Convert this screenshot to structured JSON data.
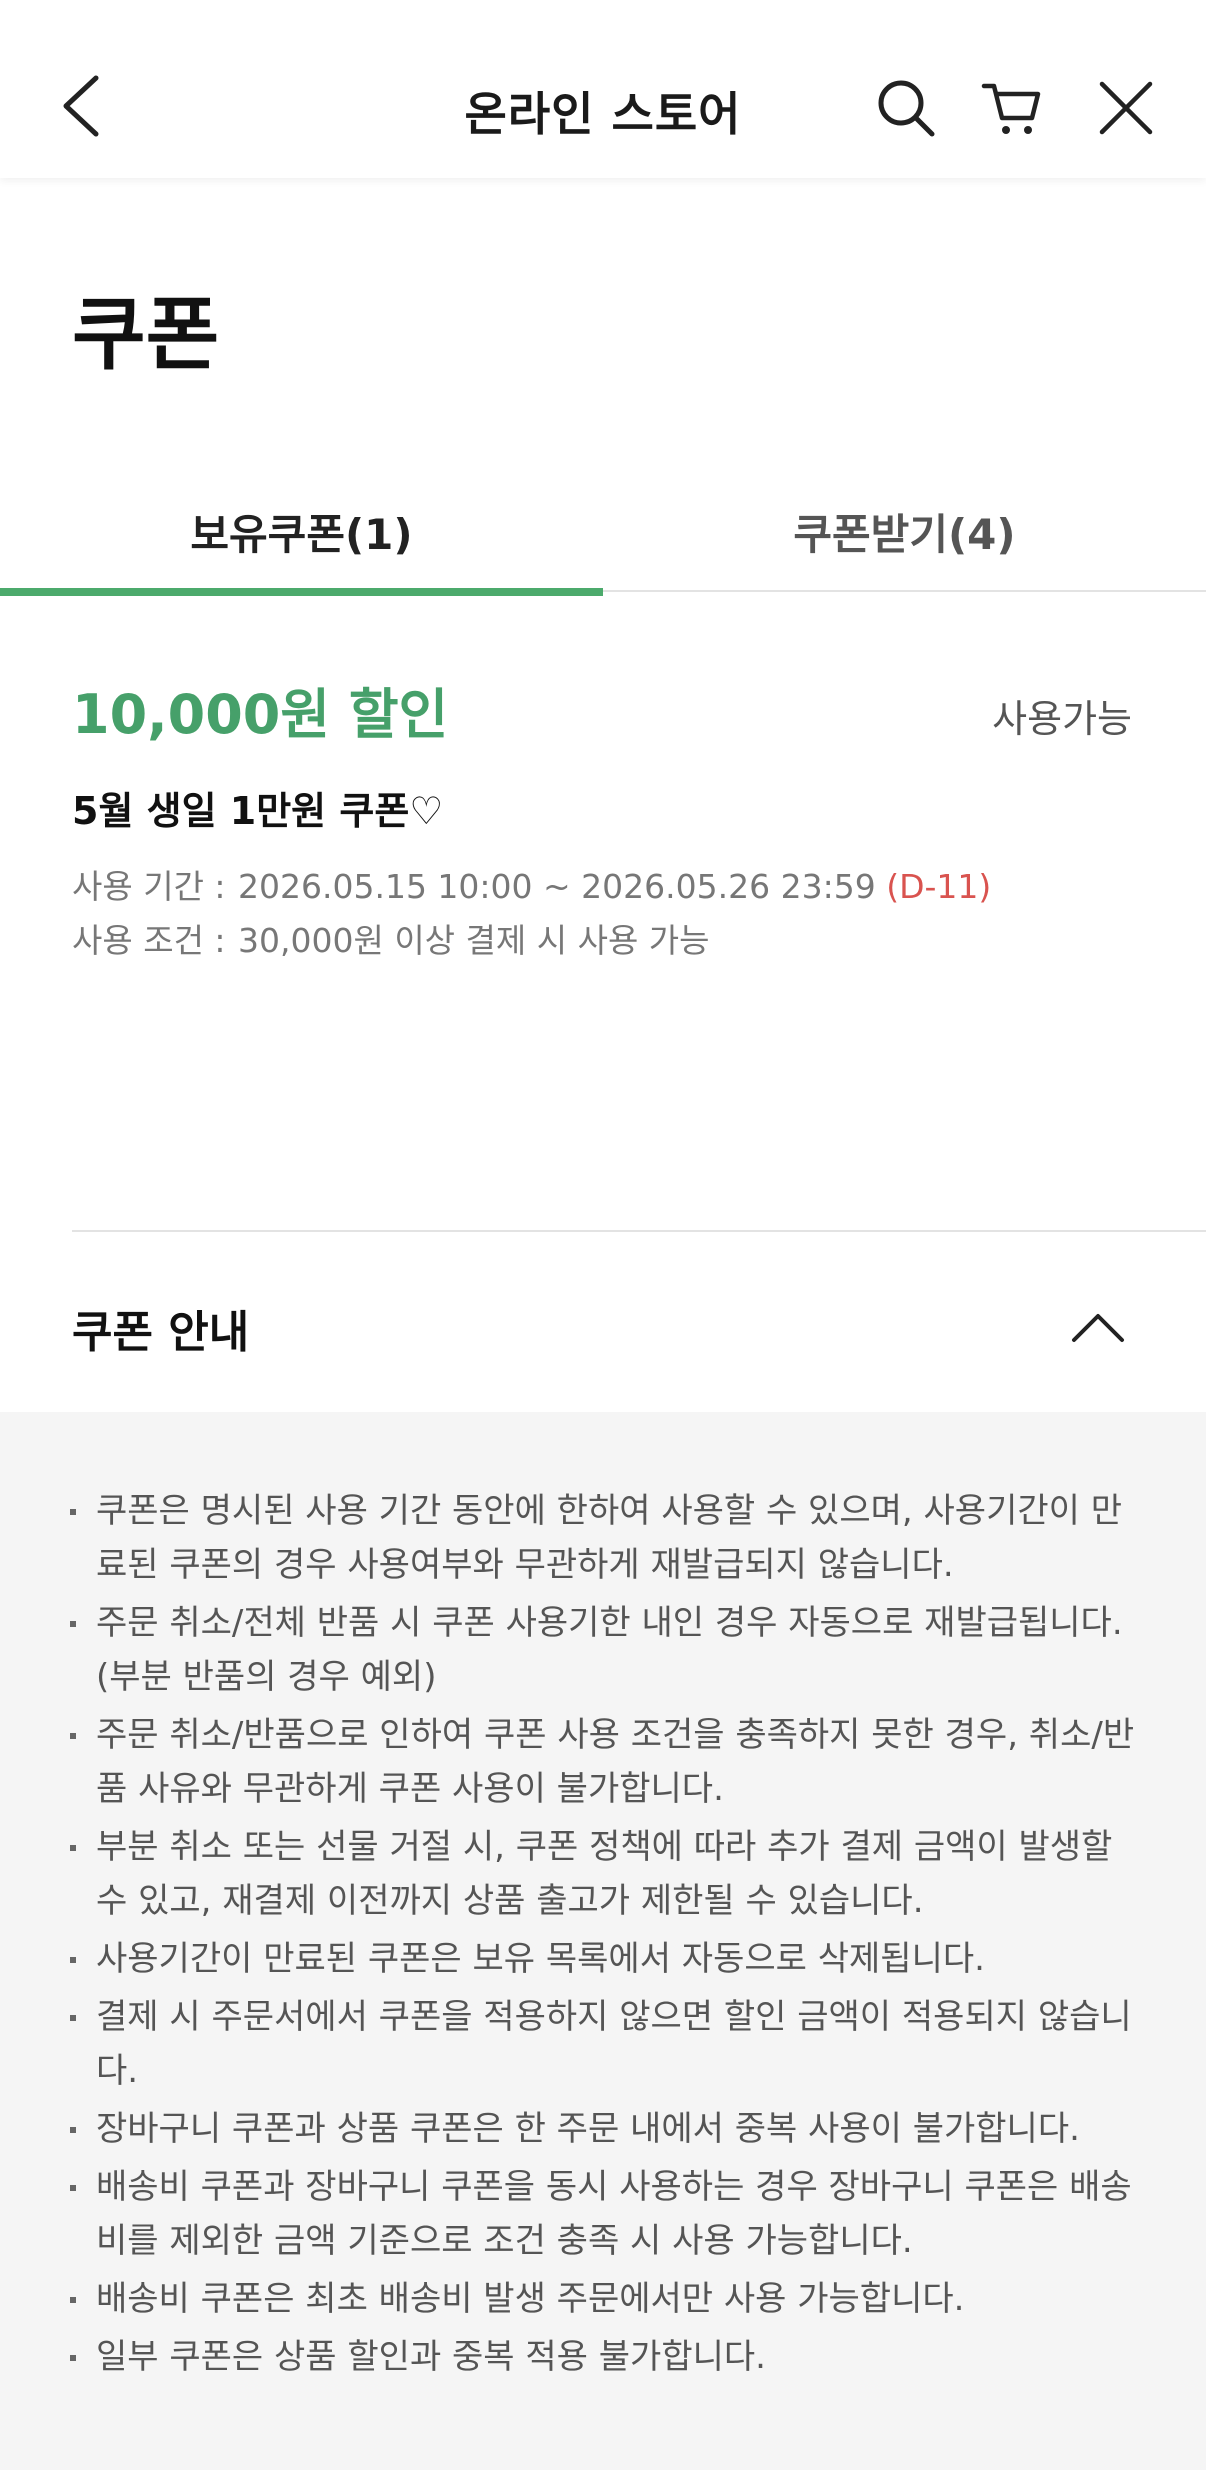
{
  "header": {
    "title": "온라인 스토어",
    "icons": [
      "back-chevron-icon",
      "search-icon",
      "cart-icon",
      "close-icon"
    ]
  },
  "page": {
    "title": "쿠폰"
  },
  "tabs": [
    {
      "label": "보유쿠폰(1)",
      "active": true
    },
    {
      "label": "쿠폰받기(4)",
      "active": false
    }
  ],
  "coupon": {
    "amount": "10,000원 할인",
    "status": "사용가능",
    "name": "5월 생일 1만원 쿠폰♡",
    "period_label": "사용 기간 :",
    "period_value": "2026.05.15 10:00 ~ 2026.05.26 23:59",
    "dday": "(D-11)",
    "condition_label": "사용 조건 :",
    "condition_value": "30,000원 이상 결제 시 사용 가능"
  },
  "guide": {
    "title": "쿠폰 안내",
    "items": [
      "쿠폰은 명시된 사용 기간 동안에 한하여 사용할 수 있으며, 사용기간이 만료된 쿠폰의 경우 사용여부와 무관하게 재발급되지 않습니다.",
      "주문 취소/전체 반품 시 쿠폰 사용기한 내인 경우 자동으로 재발급됩니다. (부분 반품의 경우 예외)",
      "주문 취소/반품으로 인하여 쿠폰 사용 조건을 충족하지 못한 경우, 취소/반품 사유와 무관하게 쿠폰 사용이 불가합니다.",
      "부분 취소 또는 선물 거절 시, 쿠폰 정책에 따라 추가 결제 금액이 발생할 수 있고, 재결제 이전까지 상품 출고가 제한될 수 있습니다.",
      "사용기간이 만료된 쿠폰은 보유 목록에서 자동으로 삭제됩니다.",
      "결제 시 주문서에서 쿠폰을 적용하지 않으면 할인 금액이 적용되지 않습니다.",
      "장바구니 쿠폰과 상품 쿠폰은 한 주문 내에서 중복 사용이 불가합니다.",
      "배송비 쿠폰과 장바구니 쿠폰을 동시 사용하는 경우 장바구니 쿠폰은 배송비를 제외한 금액 기준으로 조건 충족 시 사용 가능합니다.",
      "배송비 쿠폰은 최초 배송비 발생 주문에서만 사용 가능합니다.",
      "일부 쿠폰은 상품 할인과 중복 적용 불가합니다."
    ]
  },
  "colors": {
    "accent": "#4caa6c",
    "amount": "#46a06a",
    "dday": "#d9534f",
    "guide_bg": "#f5f5f5"
  }
}
